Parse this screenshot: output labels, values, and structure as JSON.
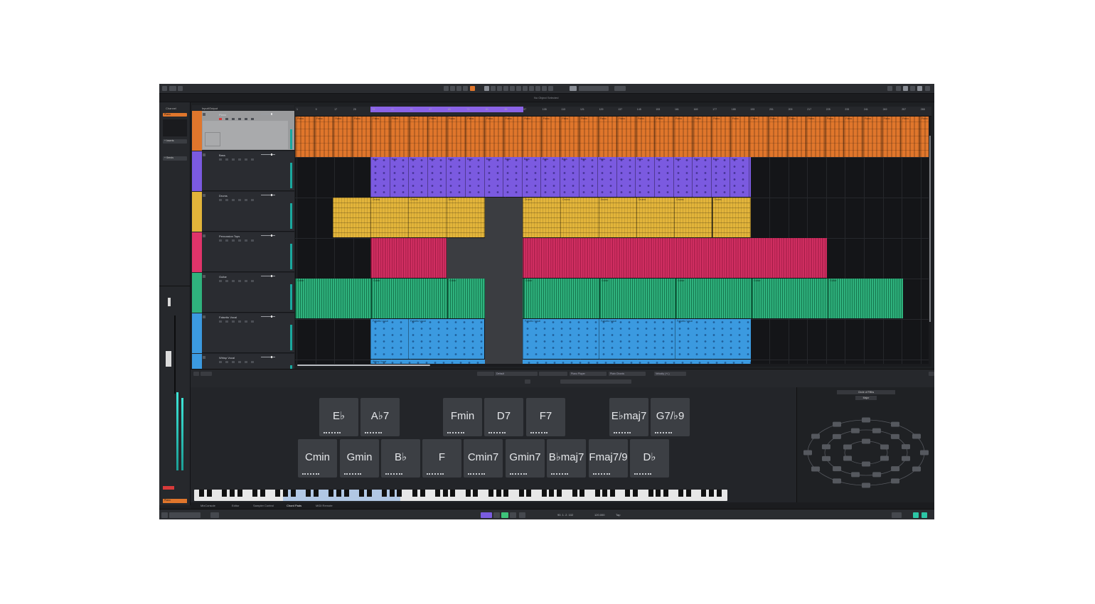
{
  "status_text": "No Object Selected",
  "inspector": {
    "channel_label": "Channel",
    "track_label": "Piano",
    "inserts_label": "+ Inserts",
    "sends_label": "+ Sends",
    "bottom_label": "Piano"
  },
  "header": {
    "input_label": "Input/Output"
  },
  "tracks": [
    {
      "name": "Piano",
      "color": "#e0762c"
    },
    {
      "name": "Bass",
      "color": "#7b5ae0"
    },
    {
      "name": "Drums",
      "color": "#e2b43a"
    },
    {
      "name": "Percussion Tops",
      "color": "#e0346a"
    },
    {
      "name": "Guitar",
      "color": "#2fb27d"
    },
    {
      "name": "Falsetto Vocal",
      "color": "#3b9ae0"
    },
    {
      "name": "Whisp Vocal",
      "color": "#3b9ae0"
    }
  ],
  "ruler_ticks": [
    "1",
    "9",
    "17",
    "25",
    "33",
    "41",
    "49",
    "57",
    "65",
    "73",
    "81",
    "89",
    "97",
    "105",
    "113",
    "121",
    "129",
    "137",
    "145",
    "153",
    "161",
    "169",
    "177",
    "185",
    "193",
    "201",
    "209",
    "217",
    "225",
    "233",
    "241",
    "249",
    "257",
    "265"
  ],
  "clip_labels": {
    "piano": "Piano",
    "bass": "Bass",
    "drums": "Drums",
    "guitar": "Guitar",
    "vocal": "Falsetto Vocal",
    "vocal2": "Whisp Vocal"
  },
  "lower_toolbar": {
    "preset": "Default",
    "instrument": "Piano Player",
    "chord_mode": "Plain Chords",
    "velocity_label": "Velocity (+/-)"
  },
  "chords_row1": [
    "E♭",
    "A♭7",
    "Fmin",
    "D7",
    "F7",
    "E♭maj7",
    "G7/♭9"
  ],
  "chords_row2": [
    "Cmin",
    "Gmin",
    "B♭",
    "F",
    "Cmin7",
    "Gmin7",
    "B♭maj7",
    "Fmaj7/9",
    "D♭"
  ],
  "circle_panel": {
    "title": "Circle of Fifths",
    "mode": "Major"
  },
  "bottom_tabs": [
    "MixConsole",
    "Editor",
    "Sampler Control",
    "Chord Pads",
    "MIDI Remote"
  ],
  "transport": {
    "position": "90. 1. 2. 102",
    "tempo": "120.000",
    "signature": "Tap"
  },
  "colors": {
    "piano": "#e0762c",
    "bass": "#7b5ae0",
    "drums": "#e2b43a",
    "perc": "#e0346a",
    "guitar": "#2fb27d",
    "vocal": "#3b9ae0",
    "loop": "#8a63e6"
  }
}
